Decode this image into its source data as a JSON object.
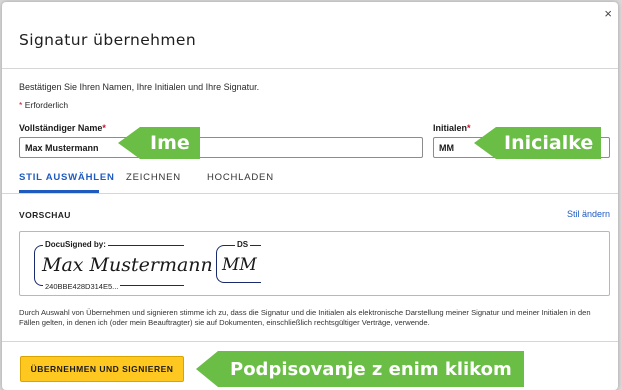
{
  "dialog": {
    "title": "Signatur übernehmen",
    "close_label": "×",
    "intro": "Bestätigen Sie Ihren Namen, Ihre Initialen und Ihre Signatur.",
    "required_star": "*",
    "required_note": "Erforderlich"
  },
  "form": {
    "full_name_label": "Vollständiger Name",
    "full_name_value": "Max Mustermann",
    "initials_label": "Initialen",
    "initials_value": "MM",
    "required_star": "*"
  },
  "tabs": [
    {
      "label": "STIL AUSWÄHLEN",
      "active": true
    },
    {
      "label": "ZEICHNEN",
      "active": false
    },
    {
      "label": "HOCHLADEN",
      "active": false
    }
  ],
  "preview": {
    "label": "VORSCHAU",
    "change_style": "Stil ändern",
    "signature_header": "DocuSigned by:",
    "signature_script": "Max Mustermann",
    "signature_id": "240BBE428D314E5...",
    "initials_header": "DS",
    "initials_script": "MM"
  },
  "disclaimer": "Durch Auswahl von Übernehmen und signieren stimme ich zu, dass die Signatur und die Initialen als elektronische Darstellung meiner Signatur und meiner Initialen in den Fällen gelten, in denen ich (oder mein Beauftragter) sie auf Dokumenten, einschließlich rechtsgültiger Verträge, verwende.",
  "actions": {
    "adopt_sign": "ÜBERNEHMEN UND SIGNIEREN"
  },
  "callouts": {
    "name": "Ime",
    "initials": "Inicialke",
    "one_click": "Podpisovanje z enim klikom"
  },
  "colors": {
    "accent_blue": "#1f5bbf",
    "button_yellow": "#ffc820",
    "callout_green": "#6abd45",
    "required_red": "#c8102e",
    "signature_ink": "#1a2b6b"
  }
}
